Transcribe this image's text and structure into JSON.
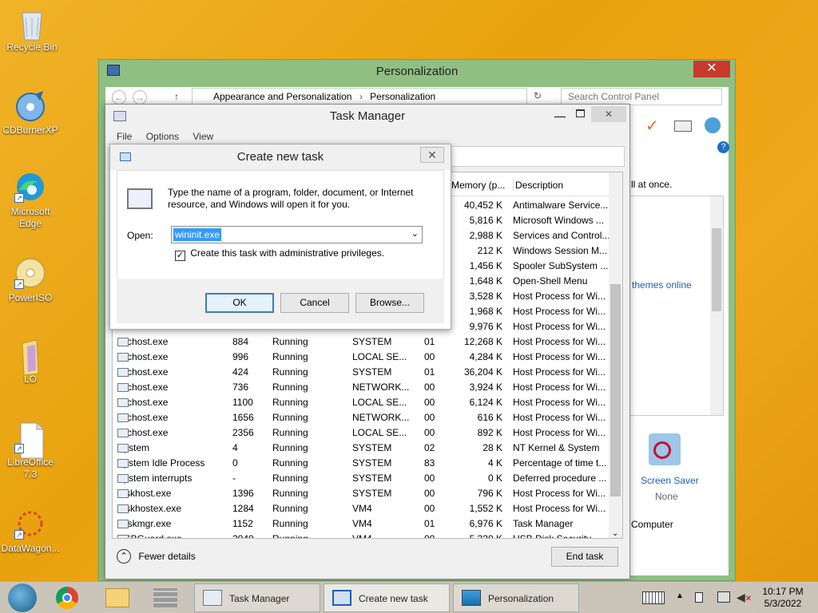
{
  "desktop": {
    "icons": [
      {
        "label": "Recycle Bin",
        "icon": "recycle-bin-icon"
      },
      {
        "label": "CDBurnerXP",
        "icon": "cdburnerxp-icon"
      },
      {
        "label": "Microsoft Edge",
        "icon": "edge-icon"
      },
      {
        "label": "PowerISO",
        "icon": "poweriso-icon"
      },
      {
        "label": "LO",
        "icon": "folder-icon"
      },
      {
        "label": "LibreOffice 7.3",
        "icon": "libreoffice-icon"
      },
      {
        "label": "DataWagon...",
        "icon": "datawagon-icon"
      }
    ]
  },
  "personalization": {
    "title": "Personalization",
    "breadcrumb": [
      "Appearance and Personalization",
      "Personalization"
    ],
    "search_placeholder": "Search Control Panel",
    "text_all_once": "ll at once.",
    "themes_online": "themes online",
    "screen_saver": {
      "label": "Screen Saver",
      "value": "None"
    },
    "computer": "Computer"
  },
  "task_manager": {
    "title": "Task Manager",
    "menu": [
      "File",
      "Options",
      "View"
    ],
    "columns": {
      "memory": "Memory (p...",
      "description": "Description"
    },
    "upper_rows": [
      {
        "mem": "40,452 K",
        "desc": "Antimalware Service..."
      },
      {
        "mem": "5,816 K",
        "desc": "Microsoft Windows ..."
      },
      {
        "mem": "2,988 K",
        "desc": "Services and Control..."
      },
      {
        "mem": "212 K",
        "desc": "Windows Session M..."
      },
      {
        "mem": "1,456 K",
        "desc": "Spooler SubSystem ..."
      },
      {
        "mem": "1,648 K",
        "desc": "Open-Shell Menu"
      },
      {
        "mem": "3,528 K",
        "desc": "Host Process for Wi..."
      },
      {
        "mem": "1,968 K",
        "desc": "Host Process for Wi..."
      },
      {
        "mem": "9,976 K",
        "desc": "Host Process for Wi..."
      }
    ],
    "rows": [
      {
        "name": "svchost.exe",
        "pid": "884",
        "status": "Running",
        "user": "SYSTEM",
        "cpu": "01",
        "mem": "12,268 K",
        "desc": "Host Process for Wi..."
      },
      {
        "name": "svchost.exe",
        "pid": "996",
        "status": "Running",
        "user": "LOCAL SE...",
        "cpu": "00",
        "mem": "4,284 K",
        "desc": "Host Process for Wi..."
      },
      {
        "name": "svchost.exe",
        "pid": "424",
        "status": "Running",
        "user": "SYSTEM",
        "cpu": "01",
        "mem": "36,204 K",
        "desc": "Host Process for Wi..."
      },
      {
        "name": "svchost.exe",
        "pid": "736",
        "status": "Running",
        "user": "NETWORK...",
        "cpu": "00",
        "mem": "3,924 K",
        "desc": "Host Process for Wi..."
      },
      {
        "name": "svchost.exe",
        "pid": "1100",
        "status": "Running",
        "user": "LOCAL SE...",
        "cpu": "00",
        "mem": "6,124 K",
        "desc": "Host Process for Wi..."
      },
      {
        "name": "svchost.exe",
        "pid": "1656",
        "status": "Running",
        "user": "NETWORK...",
        "cpu": "00",
        "mem": "616 K",
        "desc": "Host Process for Wi..."
      },
      {
        "name": "svchost.exe",
        "pid": "2356",
        "status": "Running",
        "user": "LOCAL SE...",
        "cpu": "00",
        "mem": "892 K",
        "desc": "Host Process for Wi..."
      },
      {
        "name": "System",
        "pid": "4",
        "status": "Running",
        "user": "SYSTEM",
        "cpu": "02",
        "mem": "28 K",
        "desc": "NT Kernel & System"
      },
      {
        "name": "System Idle Process",
        "pid": "0",
        "status": "Running",
        "user": "SYSTEM",
        "cpu": "83",
        "mem": "4 K",
        "desc": "Percentage of time t..."
      },
      {
        "name": "System interrupts",
        "pid": "-",
        "status": "Running",
        "user": "SYSTEM",
        "cpu": "00",
        "mem": "0 K",
        "desc": "Deferred procedure ..."
      },
      {
        "name": "taskhost.exe",
        "pid": "1396",
        "status": "Running",
        "user": "SYSTEM",
        "cpu": "00",
        "mem": "796 K",
        "desc": "Host Process for Wi..."
      },
      {
        "name": "taskhostex.exe",
        "pid": "1284",
        "status": "Running",
        "user": "VM4",
        "cpu": "00",
        "mem": "1,552 K",
        "desc": "Host Process for Wi..."
      },
      {
        "name": "Taskmgr.exe",
        "pid": "1152",
        "status": "Running",
        "user": "VM4",
        "cpu": "01",
        "mem": "6,976 K",
        "desc": "Task Manager"
      },
      {
        "name": "USBGuard.exe",
        "pid": "2040",
        "status": "Running",
        "user": "VM4",
        "cpu": "00",
        "mem": "5,320 K",
        "desc": "USB Disk Security"
      }
    ],
    "fewer_details": "Fewer details",
    "end_task": "End task"
  },
  "dialog": {
    "title": "Create new task",
    "message": "Type the name of a program, folder, document, or Internet resource, and Windows will open it for you.",
    "open_label": "Open:",
    "open_value": "wininit.exe",
    "admin_checkbox": "Create this task with administrative privileges.",
    "admin_checked": true,
    "ok": "OK",
    "cancel": "Cancel",
    "browse": "Browse..."
  },
  "taskbar": {
    "buttons": [
      "Task Manager",
      "Create new task",
      "Personalization"
    ],
    "time": "10:17 PM",
    "date": "5/3/2022"
  }
}
